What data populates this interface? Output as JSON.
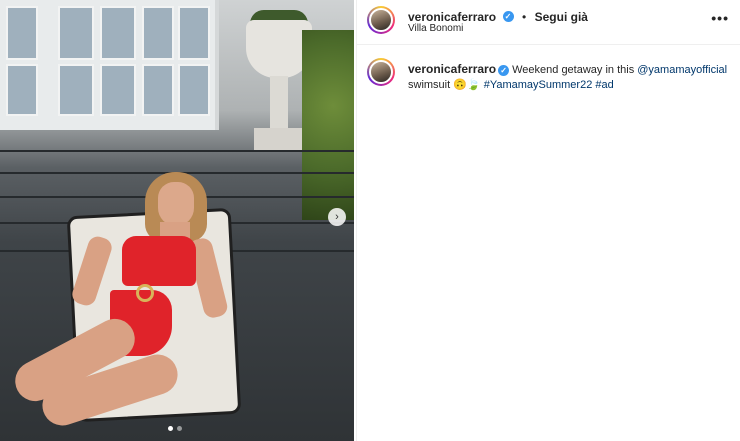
{
  "post": {
    "carousel": {
      "total_slides": 2,
      "current_slide": 1
    }
  },
  "header": {
    "username": "veronicaferraro",
    "verified_icon": "verified-badge-icon",
    "separator": "•",
    "follow_label": "Segui già",
    "location": "Villa Bonomi",
    "more_icon": "•••"
  },
  "caption": {
    "username": "veronicaferraro",
    "text_1": "Weekend getaway in this ",
    "mention": "@yamamayofficial",
    "text_2": "swimsuit ",
    "emoji": "🙃🍃",
    "hashtag_1": "#YamamaySummer22",
    "hashtag_2": "#ad"
  },
  "colors": {
    "verified": "#3897f0",
    "link": "#00376b",
    "swimsuit": "#e0232a"
  }
}
